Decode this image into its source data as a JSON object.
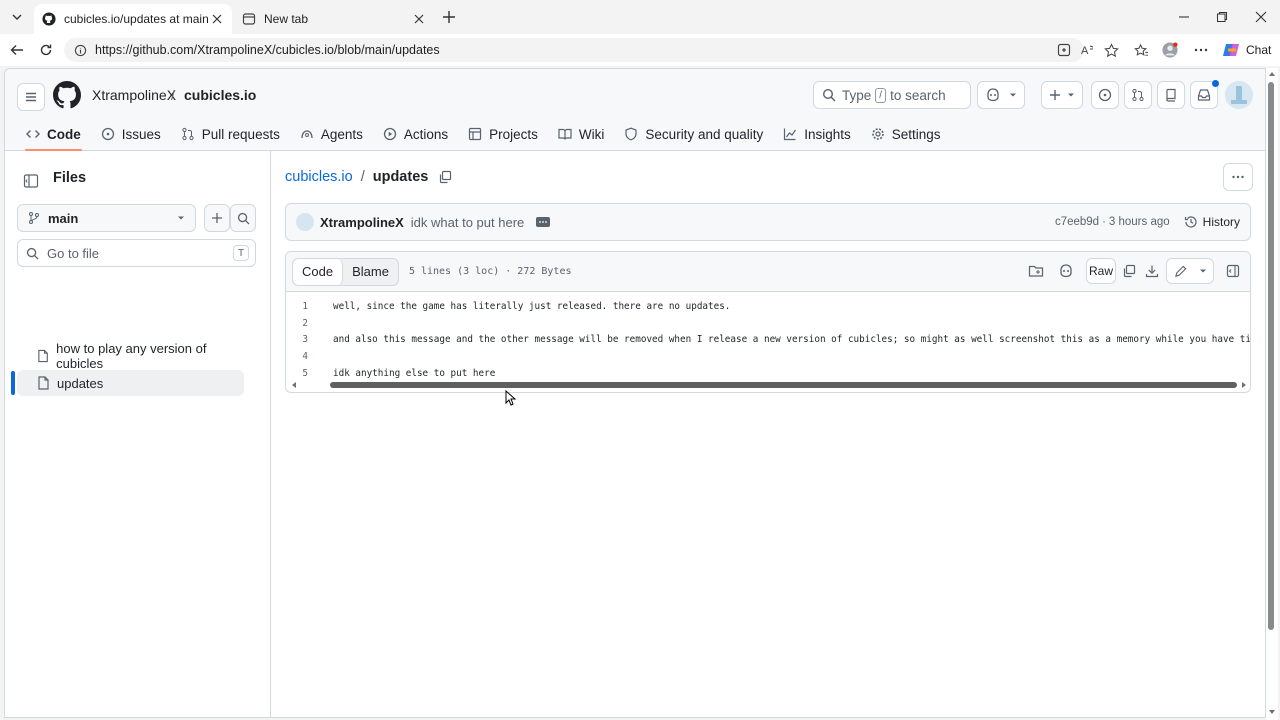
{
  "browser": {
    "tabs": [
      {
        "title": "cubicles.io/updates at main · XtrampolineX",
        "active": true
      },
      {
        "title": "New tab",
        "active": false
      }
    ],
    "url": "https://github.com/XtrampolineX/cubicles.io/blob/main/updates",
    "chat_label": "Chat"
  },
  "header": {
    "owner": "XtrampolineX",
    "separator": "/",
    "repo": "cubicles.io",
    "search_prefix": "Type",
    "search_key": "/",
    "search_suffix": "to search"
  },
  "repo_nav": [
    {
      "label": "Code",
      "icon": "code-icon",
      "selected": true
    },
    {
      "label": "Issues",
      "icon": "issue-icon"
    },
    {
      "label": "Pull requests",
      "icon": "pull-request-icon"
    },
    {
      "label": "Agents",
      "icon": "agents-icon"
    },
    {
      "label": "Actions",
      "icon": "play-icon"
    },
    {
      "label": "Projects",
      "icon": "table-icon"
    },
    {
      "label": "Wiki",
      "icon": "book-icon"
    },
    {
      "label": "Security and quality",
      "icon": "shield-icon"
    },
    {
      "label": "Insights",
      "icon": "graph-icon"
    },
    {
      "label": "Settings",
      "icon": "gear-icon"
    }
  ],
  "sidebar": {
    "title": "Files",
    "branch": "main",
    "goto_placeholder": "Go to file",
    "goto_key": "T",
    "files": [
      {
        "name": "how to play any version of cubicles",
        "active": false
      },
      {
        "name": "updates",
        "active": true
      }
    ]
  },
  "main": {
    "path_repo": "cubicles.io",
    "path_sep": "/",
    "path_file": "updates",
    "commit": {
      "author": "XtrampolineX",
      "message": "idk what to put here",
      "sha": "c7eeb9d",
      "dot": "·",
      "time": "3 hours ago",
      "history_label": "History"
    },
    "file": {
      "tab_code": "Code",
      "tab_blame": "Blame",
      "meta": "5 lines (3 loc) · 272 Bytes",
      "raw_label": "Raw",
      "lines": [
        {
          "n": "1",
          "text": "well, since the game has literally just released. there are no updates."
        },
        {
          "n": "2",
          "text": ""
        },
        {
          "n": "3",
          "text": "and also this message and the other message will be removed when I release a new version of cubicles; so might as well screenshot this as a memory while you have time."
        },
        {
          "n": "4",
          "text": ""
        },
        {
          "n": "5",
          "text": "idk anything else to put here"
        }
      ]
    }
  }
}
